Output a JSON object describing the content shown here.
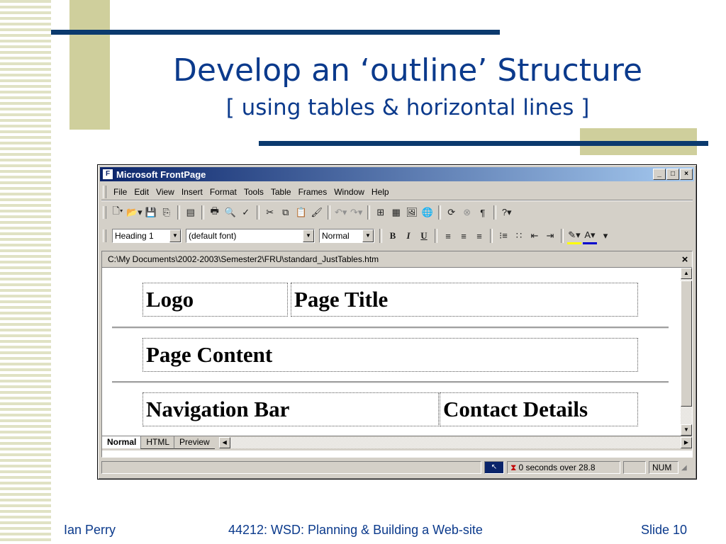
{
  "slide": {
    "title": "Develop an ‘outline’ Structure",
    "subtitle": "[ using tables & horizontal lines ]",
    "footer_left": "Ian Perry",
    "footer_center": "44212: WSD: Planning & Building a Web-site",
    "footer_right": "Slide 10"
  },
  "window": {
    "title": "Microsoft FrontPage",
    "controls": [
      "_",
      "□",
      "×"
    ]
  },
  "menu": [
    "File",
    "Edit",
    "View",
    "Insert",
    "Format",
    "Tools",
    "Table",
    "Frames",
    "Window",
    "Help"
  ],
  "formatting": {
    "style": "Heading 1",
    "font": "(default font)",
    "size": "Normal",
    "bold": "B",
    "italic": "I",
    "underline": "U",
    "highlight_color": "#ffff00",
    "font_color": "#0000cc"
  },
  "document": {
    "path": "C:\\My Documents\\2002-2003\\Semester2\\FRU\\standard_JustTables.htm",
    "close": "×",
    "cells": {
      "logo": "Logo",
      "page_title": "Page Title",
      "page_content": "Page Content",
      "navigation_bar": "Navigation Bar",
      "contact_details": "Contact Details"
    }
  },
  "view_tabs": [
    "Normal",
    "HTML",
    "Preview"
  ],
  "active_view": "Normal",
  "status": {
    "download_time": "0 seconds over 28.8",
    "num": "NUM"
  },
  "colors": {
    "slide_text": "#0b3a8c",
    "accent_navy": "#0b3a6e",
    "accent_olive": "#cfcf9c",
    "titlebar_start": "#0a246a"
  }
}
